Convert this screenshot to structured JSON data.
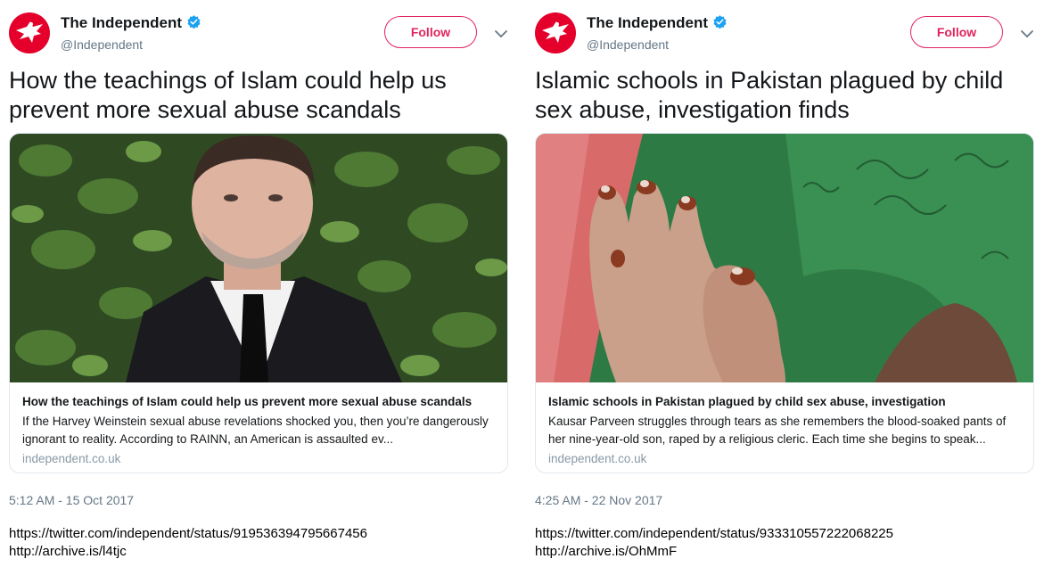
{
  "brand_color": "#e4002b",
  "follow_color": "#e0245e",
  "tweets": [
    {
      "account_name": "The Independent",
      "handle": "@Independent",
      "follow_label": "Follow",
      "text": "How the teachings of Islam could help us prevent more sexual abuse scandals",
      "card": {
        "title": "How the teachings of Islam could help us prevent more sexual abuse scandals",
        "description": "If the Harvey Weinstein sexual abuse revelations shocked you, then you’re dangerously ignorant to reality. According to RAINN, an American is assaulted ev...",
        "domain": "independent.co.uk",
        "image_subject": "man in dark suit and tie in front of leafy hedge"
      },
      "timestamp": "5:12 AM - 15 Oct 2017",
      "status_url": "https://twitter.com/independent/status/919536394795667456",
      "archive_url": "http://archive.is/l4tjc"
    },
    {
      "account_name": "The Independent",
      "handle": "@Independent",
      "follow_label": "Follow",
      "text": "Islamic schools in Pakistan plagued by child sex abuse, investigation finds",
      "card": {
        "title": "Islamic schools in Pakistan plagued by child sex abuse, investigation",
        "description": "Kausar Parveen struggles through tears as she remembers the blood-soaked pants of her nine-year-old son, raped by a religious cleric. Each time she begins to speak...",
        "domain": "independent.co.uk",
        "image_subject": "hennaed hands pressed together in front of green scarf"
      },
      "timestamp": "4:25 AM - 22 Nov 2017",
      "status_url": "https://twitter.com/independent/status/933310557222068225",
      "archive_url": "http://archive.is/OhMmF"
    }
  ]
}
